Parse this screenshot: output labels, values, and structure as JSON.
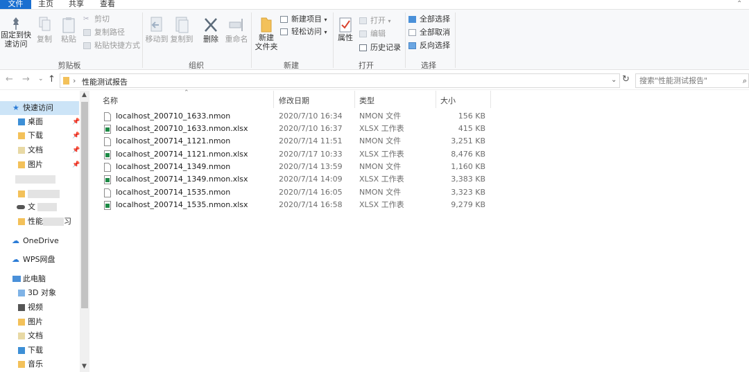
{
  "tabs": {
    "file": "文件",
    "home": "主页",
    "share": "共享",
    "view": "查看"
  },
  "ribbon": {
    "pin": "固定到快速访问",
    "pin_line1": "固定到快",
    "pin_line2": "速访问",
    "copy": "复制",
    "paste": "粘贴",
    "cut": "剪切",
    "copy_path": "复制路径",
    "paste_shortcut": "粘贴快捷方式",
    "move_to": "移动到",
    "copy_to": "复制到",
    "delete": "删除",
    "rename": "重命名",
    "new_folder_line1": "新建",
    "new_folder_line2": "文件夹",
    "new_item": "新建项目",
    "easy_access": "轻松访问",
    "properties": "属性",
    "open": "打开",
    "edit": "编辑",
    "history": "历史记录",
    "select_all": "全部选择",
    "select_none": "全部取消",
    "invert_selection": "反向选择",
    "groups": {
      "clipboard": "剪贴板",
      "organize": "组织",
      "new": "新建",
      "open": "打开",
      "select": "选择"
    }
  },
  "address": {
    "path": "性能测试报告",
    "search_placeholder": "搜索\"性能测试报告\""
  },
  "nav": {
    "quick_access": "快速访问",
    "items": [
      "桌面",
      "下载",
      "文档",
      "图片"
    ],
    "blurred": [
      "",
      "",
      "文",
      "性能"
    ],
    "blurred_tail": [
      "",
      "",
      "",
      "习"
    ],
    "onedrive": "OneDrive",
    "wps": "WPS网盘",
    "this_pc": "此电脑",
    "pc_items": [
      "3D 对象",
      "视频",
      "图片",
      "文档",
      "下载",
      "音乐"
    ]
  },
  "columns": {
    "name": "名称",
    "date": "修改日期",
    "type": "类型",
    "size": "大小"
  },
  "files": [
    {
      "name": "localhost_200710_1633.nmon",
      "date": "2020/7/10 16:34",
      "type": "NMON 文件",
      "size": "156 KB",
      "icon": "file-icon"
    },
    {
      "name": "localhost_200710_1633.nmon.xlsx",
      "date": "2020/7/10 16:37",
      "type": "XLSX 工作表",
      "size": "415 KB",
      "icon": "xlsx-icon"
    },
    {
      "name": "localhost_200714_1121.nmon",
      "date": "2020/7/14 11:51",
      "type": "NMON 文件",
      "size": "3,251 KB",
      "icon": "file-icon"
    },
    {
      "name": "localhost_200714_1121.nmon.xlsx",
      "date": "2020/7/17 10:33",
      "type": "XLSX 工作表",
      "size": "8,476 KB",
      "icon": "xlsx-icon"
    },
    {
      "name": "localhost_200714_1349.nmon",
      "date": "2020/7/14 13:59",
      "type": "NMON 文件",
      "size": "1,160 KB",
      "icon": "file-icon"
    },
    {
      "name": "localhost_200714_1349.nmon.xlsx",
      "date": "2020/7/14 14:09",
      "type": "XLSX 工作表",
      "size": "3,383 KB",
      "icon": "xlsx-icon"
    },
    {
      "name": "localhost_200714_1535.nmon",
      "date": "2020/7/14 16:05",
      "type": "NMON 文件",
      "size": "3,323 KB",
      "icon": "file-icon"
    },
    {
      "name": "localhost_200714_1535.nmon.xlsx",
      "date": "2020/7/14 16:58",
      "type": "XLSX 工作表",
      "size": "9,279 KB",
      "icon": "xlsx-icon"
    }
  ]
}
